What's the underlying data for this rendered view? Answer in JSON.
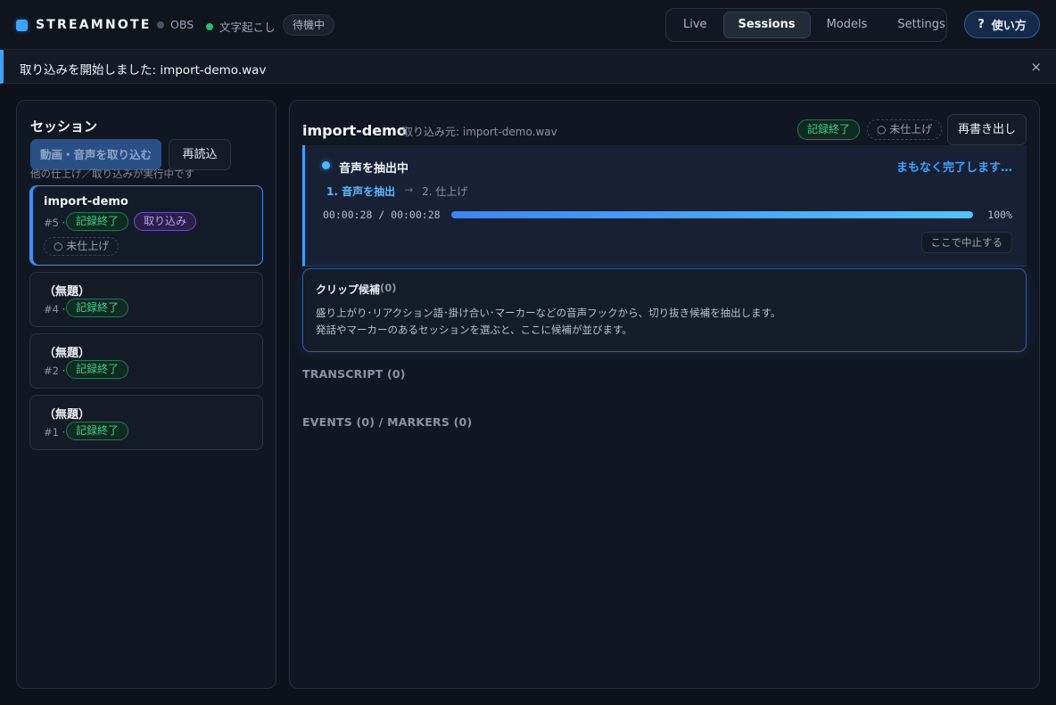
{
  "app": {
    "brand": "STREAMNOTE",
    "status": [
      {
        "label": "OBS",
        "color": "#4a5263"
      },
      {
        "label": "文字起こし",
        "color": "#23c26b"
      }
    ],
    "state_pill": "待機中"
  },
  "nav": {
    "tabs": [
      "Live",
      "Sessions",
      "Models",
      "Settings"
    ],
    "active": "Sessions"
  },
  "help": {
    "icon": "?",
    "label": "使い方"
  },
  "banner": {
    "text": "取り込みを開始しました: import-demo.wav",
    "close": "×"
  },
  "sidebar": {
    "title": "セッション",
    "import_button": "動画・音声を取り込む",
    "reload_button": "再読込",
    "note": "他の仕上げ／取り込みが実行中です",
    "sessions": [
      {
        "title": "import-demo",
        "num": "#5 ·",
        "status": "記録終了",
        "tag": "取り込み",
        "finish": "○ 未仕上げ",
        "selected": true
      },
      {
        "title": "（無題）",
        "num": "#4 ·",
        "status": "記録終了"
      },
      {
        "title": "（無題）",
        "num": "#2 ·",
        "status": "記録終了"
      },
      {
        "title": "（無題）",
        "num": "#1 ·",
        "status": "記録終了"
      }
    ]
  },
  "detail": {
    "title": "import-demo",
    "source": "取り込み元: import-demo.wav",
    "status_badge": "記録終了",
    "finish_badge": "○ 未仕上げ",
    "export_button": "再書き出し",
    "progress": {
      "title": "音声を抽出中",
      "eta": "まもなく完了します…",
      "step1": "1. 音声を抽出",
      "arrow": "→",
      "step2": "2. 仕上げ",
      "time": "00:00:28 / 00:00:28",
      "percent_label": "100%",
      "fraction": 1.0,
      "stop_button": "ここで中止する"
    },
    "clips": {
      "title": "クリップ候補",
      "count": "(0)",
      "line1": "盛り上がり･リアクション語･掛け合い･マーカーなどの音声フックから、切り抜き候補を抽出します。",
      "line2": "発話やマーカーのあるセッションを選ぶと、ここに候補が並びます。"
    },
    "transcript_label": "TRANSCRIPT (0)",
    "events_label": "EVENTS (0) / MARKERS (0)"
  }
}
